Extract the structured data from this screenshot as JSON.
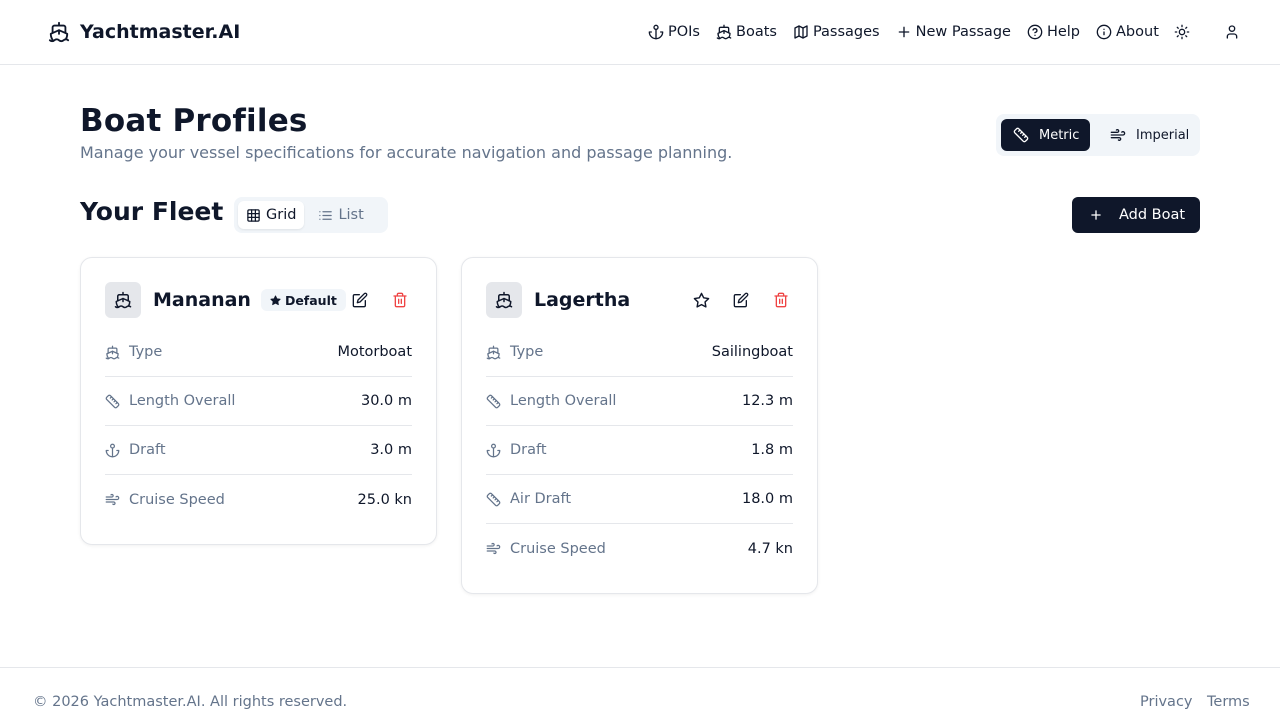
{
  "app": {
    "name": "Yachtmaster.AI",
    "logo_icon": "ship-icon"
  },
  "nav": [
    {
      "label": "POIs",
      "icon": "anchor-icon"
    },
    {
      "label": "Boats",
      "icon": "ship-icon"
    },
    {
      "label": "Passages",
      "icon": "map-icon"
    },
    {
      "label": "New Passage",
      "icon": "plus-icon"
    },
    {
      "label": "Help",
      "icon": "help-circle-icon"
    },
    {
      "label": "About",
      "icon": "info-icon"
    }
  ],
  "header_actions": [
    {
      "icon": "sun-icon"
    },
    {
      "icon": "user-icon"
    }
  ],
  "page": {
    "title": "Boat Profiles",
    "subtitle": "Manage your vessel specifications for accurate navigation and passage planning."
  },
  "units": {
    "options": [
      {
        "label": "Metric",
        "icon": "ruler-icon",
        "active": true
      },
      {
        "label": "Imperial",
        "icon": "wind-icon",
        "active": false
      }
    ]
  },
  "fleet": {
    "title": "Your Fleet",
    "views": [
      {
        "label": "Grid",
        "icon": "grid-icon",
        "active": true
      },
      {
        "label": "List",
        "icon": "list-icon",
        "active": false
      }
    ],
    "add_label": "Add Boat"
  },
  "boats": [
    {
      "name": "Mananan",
      "default": true,
      "badge_label": "Default",
      "specs": [
        {
          "label": "Type",
          "value": "Motorboat",
          "icon": "ship-icon"
        },
        {
          "label": "Length Overall",
          "value": "30.0 m",
          "icon": "ruler-icon"
        },
        {
          "label": "Draft",
          "value": "3.0 m",
          "icon": "anchor-icon"
        },
        {
          "label": "Cruise Speed",
          "value": "25.0 kn",
          "icon": "wind-icon"
        }
      ]
    },
    {
      "name": "Lagertha",
      "default": false,
      "specs": [
        {
          "label": "Type",
          "value": "Sailingboat",
          "icon": "ship-icon"
        },
        {
          "label": "Length Overall",
          "value": "12.3 m",
          "icon": "ruler-icon"
        },
        {
          "label": "Draft",
          "value": "1.8 m",
          "icon": "anchor-icon"
        },
        {
          "label": "Air Draft",
          "value": "18.0 m",
          "icon": "ruler-icon"
        },
        {
          "label": "Cruise Speed",
          "value": "4.7 kn",
          "icon": "wind-icon"
        }
      ]
    }
  ],
  "footer": {
    "copyright": "© 2026 Yachtmaster.AI. All rights reserved.",
    "links": [
      "Privacy",
      "Terms"
    ]
  },
  "colors": {
    "primary": "#0f172a",
    "muted": "#64748b",
    "danger": "#ef4444",
    "border": "#e5e7eb",
    "surface": "#f1f5f9"
  }
}
